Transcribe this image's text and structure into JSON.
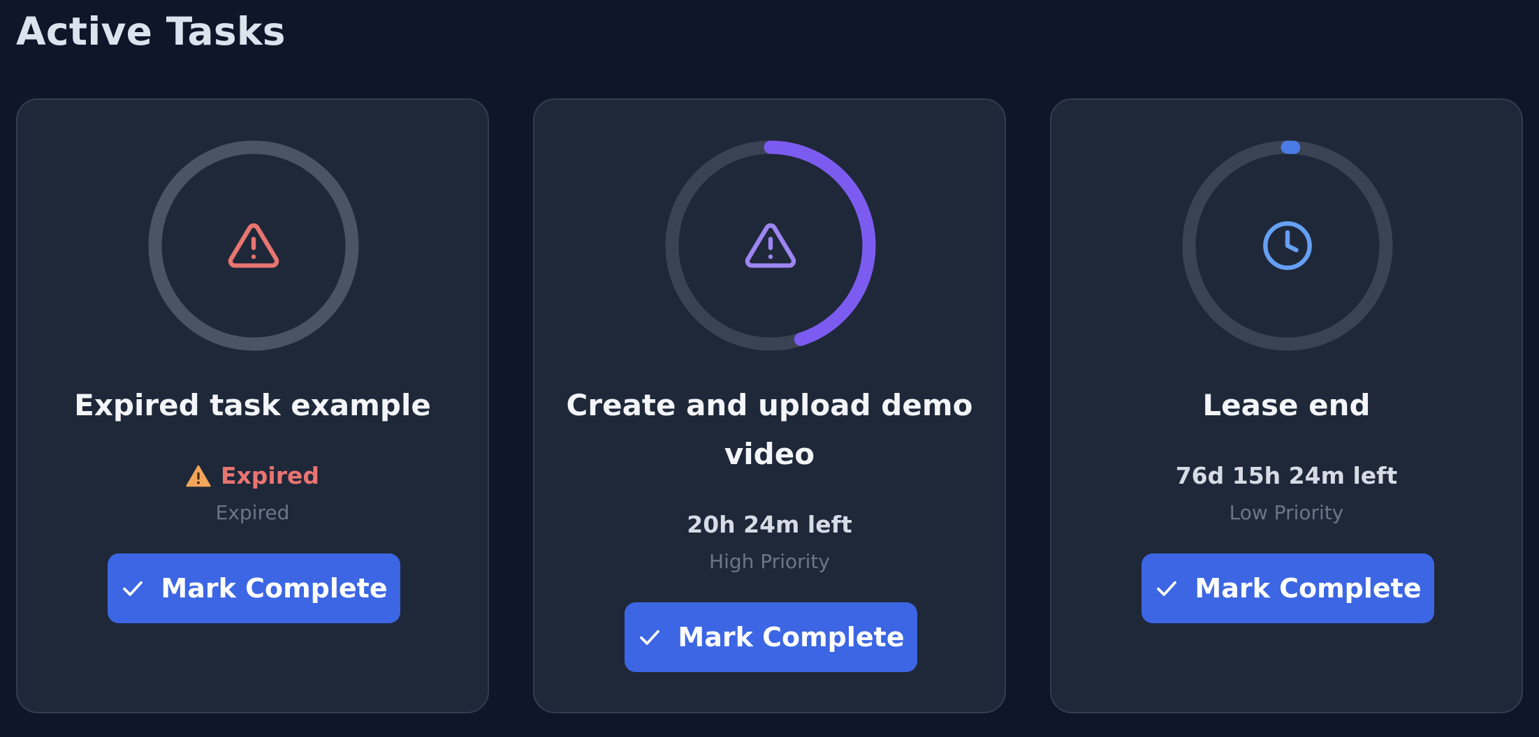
{
  "page": {
    "title": "Active Tasks"
  },
  "colors": {
    "background": "#0f1629",
    "card": "#1f2839",
    "button": "#3c66e3",
    "expired_text": "#ea7471",
    "expired_icon": "#e87570",
    "warning_badge": "#f2a65a",
    "high_priority_ring": "#7c5cf0",
    "low_priority_ring": "#4a7be6",
    "clock_icon": "#66a0f5"
  },
  "tasks": [
    {
      "title": "Expired task example",
      "status_icon": "warning-icon",
      "status": "Expired",
      "subtext": "Expired",
      "progress": 0,
      "ring_icon": "warning-icon",
      "button_label": "Mark Complete"
    },
    {
      "title": "Create and upload demo video",
      "status": "20h 24m left",
      "subtext": "High Priority",
      "progress": 0.45,
      "ring_icon": "warning-icon",
      "button_label": "Mark Complete"
    },
    {
      "title": "Lease end",
      "status": "76d 15h 24m left",
      "subtext": "Low Priority",
      "progress": 0.01,
      "ring_icon": "clock-icon",
      "button_label": "Mark Complete"
    }
  ]
}
